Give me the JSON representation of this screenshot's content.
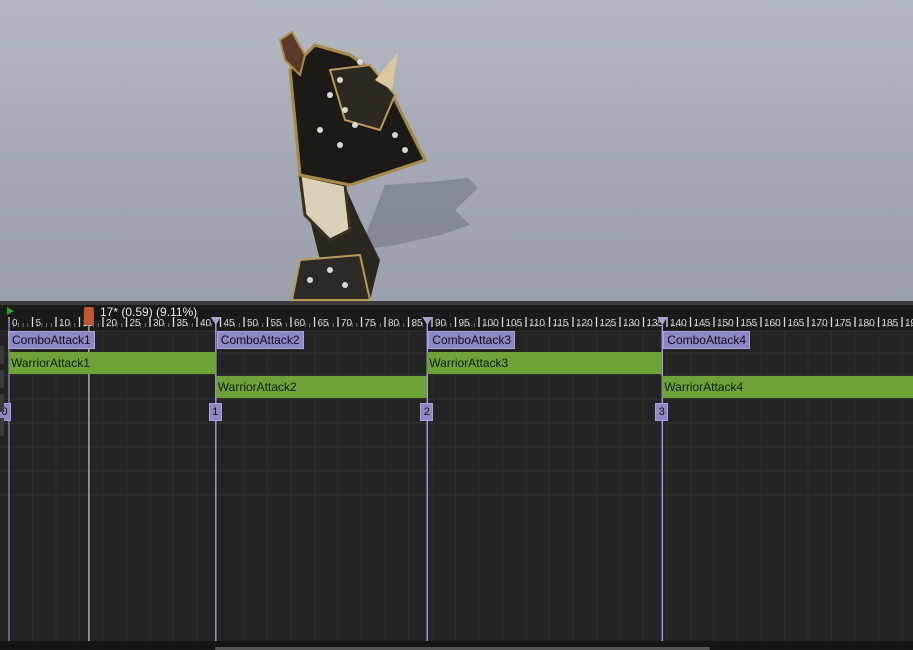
{
  "timeline": {
    "frame_readout": "17* (0.59) (9.11%)",
    "ruler_labels": [
      "0",
      "5",
      "10",
      "15",
      "20",
      "25",
      "30",
      "35",
      "40",
      "45",
      "50",
      "55",
      "60",
      "65",
      "70",
      "75",
      "80",
      "85",
      "90",
      "95",
      "100",
      "105",
      "110",
      "115",
      "120",
      "125",
      "130",
      "135",
      "140",
      "145",
      "150",
      "155",
      "160",
      "165",
      "170",
      "175",
      "180",
      "185",
      "19"
    ],
    "notifies": [
      {
        "label": "ComboAttack1",
        "frame": 0
      },
      {
        "label": "ComboAttack2",
        "frame": 44
      },
      {
        "label": "ComboAttack3",
        "frame": 89
      },
      {
        "label": "ComboAttack4",
        "frame": 139
      }
    ],
    "montage_sections": [
      {
        "label": "WarriorAttack1",
        "start": 0,
        "end": 44,
        "row": 0
      },
      {
        "label": "WarriorAttack2",
        "start": 44,
        "end": 89,
        "row": 1
      },
      {
        "label": "WarriorAttack3",
        "start": 89,
        "end": 139,
        "row": 0
      },
      {
        "label": "WarriorAttack4",
        "start": 139,
        "end": 195,
        "row": 1
      }
    ],
    "section_indices": [
      {
        "label": "0",
        "frame": 0
      },
      {
        "label": "1",
        "frame": 44
      },
      {
        "label": "2",
        "frame": 89
      },
      {
        "label": "3",
        "frame": 139
      }
    ],
    "playhead_frame": 17
  },
  "colors": {
    "notify": "#8b88c4",
    "section": "#6fa33a",
    "playhead": "#c0582f",
    "marker_line": "#9c9ae0"
  }
}
